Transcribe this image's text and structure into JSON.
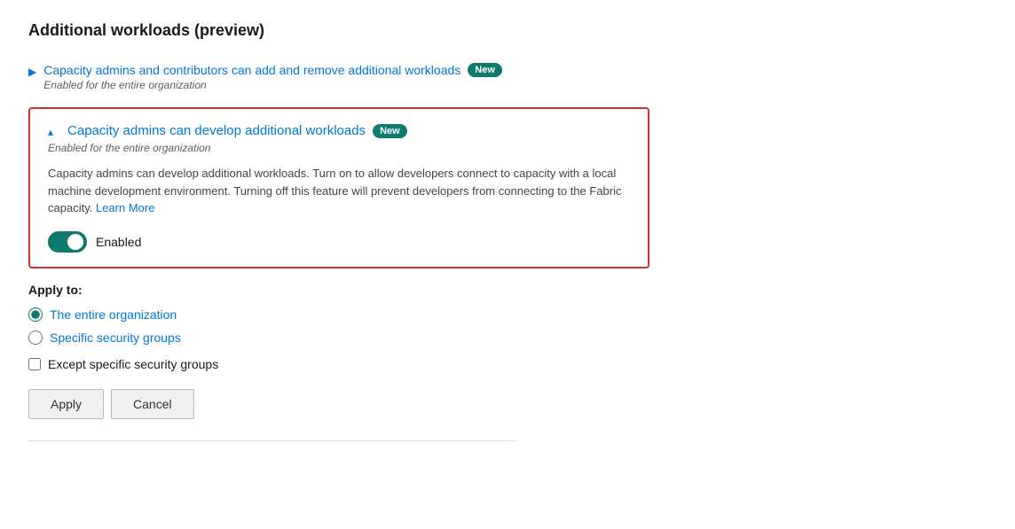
{
  "page": {
    "title": "Additional workloads (preview)"
  },
  "collapsed_item": {
    "chevron": "▶",
    "title": "Capacity admins and contributors can add and remove additional workloads",
    "badge": "New",
    "subtitle": "Enabled for the entire organization"
  },
  "expanded_item": {
    "chevron": "▴",
    "title": "Capacity admins can develop additional workloads",
    "badge": "New",
    "subtitle": "Enabled for the entire organization",
    "description_part1": "Capacity admins can develop additional workloads. Turn on to allow developers connect to capacity with a local machine development environment. Turning off this feature will prevent developers from connecting to the Fabric capacity.",
    "learn_more": "Learn More",
    "toggle_label": "Enabled",
    "toggle_state": true
  },
  "apply_to": {
    "label": "Apply to:",
    "options": [
      {
        "id": "entire-org",
        "label": "The entire organization",
        "checked": true
      },
      {
        "id": "specific-groups",
        "label": "Specific security groups",
        "checked": false
      }
    ],
    "except_checkbox": {
      "label": "Except specific security groups",
      "checked": false
    }
  },
  "buttons": {
    "apply": "Apply",
    "cancel": "Cancel"
  }
}
